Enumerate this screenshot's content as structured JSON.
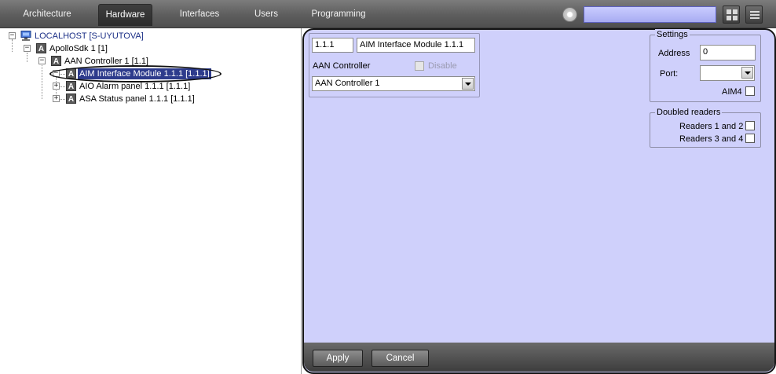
{
  "topbar": {
    "tabs": [
      {
        "label": "Architecture",
        "active": false
      },
      {
        "label": "Hardware",
        "active": true
      },
      {
        "label": "Interfaces",
        "active": false
      },
      {
        "label": "Users",
        "active": false
      },
      {
        "label": "Programming",
        "active": false
      }
    ],
    "search_value": "",
    "icons": [
      "gear-icon",
      "layout-grid-icon",
      "menu-icon"
    ]
  },
  "tree": {
    "items": [
      {
        "label": "LOCALHOST [S-UYUTOVA]",
        "icon": "computer-icon",
        "expander": "-"
      },
      {
        "label": "ApolloSdk 1 [1]",
        "icon": "apollo-a-icon",
        "expander": "-"
      },
      {
        "label": "AAN Controller 1 [1.1]",
        "icon": "apollo-a-icon",
        "expander": "-"
      },
      {
        "label": "AIM Interface Module 1.1.1 [1.1.1]",
        "icon": "apollo-a-icon",
        "expander": "-",
        "selected": true
      },
      {
        "label": "AIO Alarm panel 1.1.1 [1.1.1]",
        "icon": "apollo-a-icon",
        "expander": "+"
      },
      {
        "label": "ASA Status panel 1.1.1 [1.1.1]",
        "icon": "apollo-a-icon",
        "expander": "+"
      }
    ]
  },
  "object_card": {
    "id_value": "1.1.1",
    "name_value": "AIM Interface Module 1.1.1",
    "parent_label": "AAN Controller",
    "disable_label": "Disable",
    "disable_checked": false,
    "parent_select_value": "AAN Controller 1"
  },
  "settings": {
    "title": "Settings",
    "address_label": "Address",
    "address_value": "0",
    "port_label": "Port:",
    "port_value": "",
    "aim4_label": "AIM4",
    "aim4_checked": false
  },
  "doubled_readers": {
    "title": "Doubled readers",
    "r12_label": "Readers 1 and 2",
    "r34_label": "Readers 3 and 4"
  },
  "actions": {
    "apply_label": "Apply",
    "cancel_label": "Cancel"
  },
  "colors": {
    "panel_bg": "#cfd0fb",
    "selection": "#2d3b8c",
    "topbar": "#5d5d5d"
  }
}
